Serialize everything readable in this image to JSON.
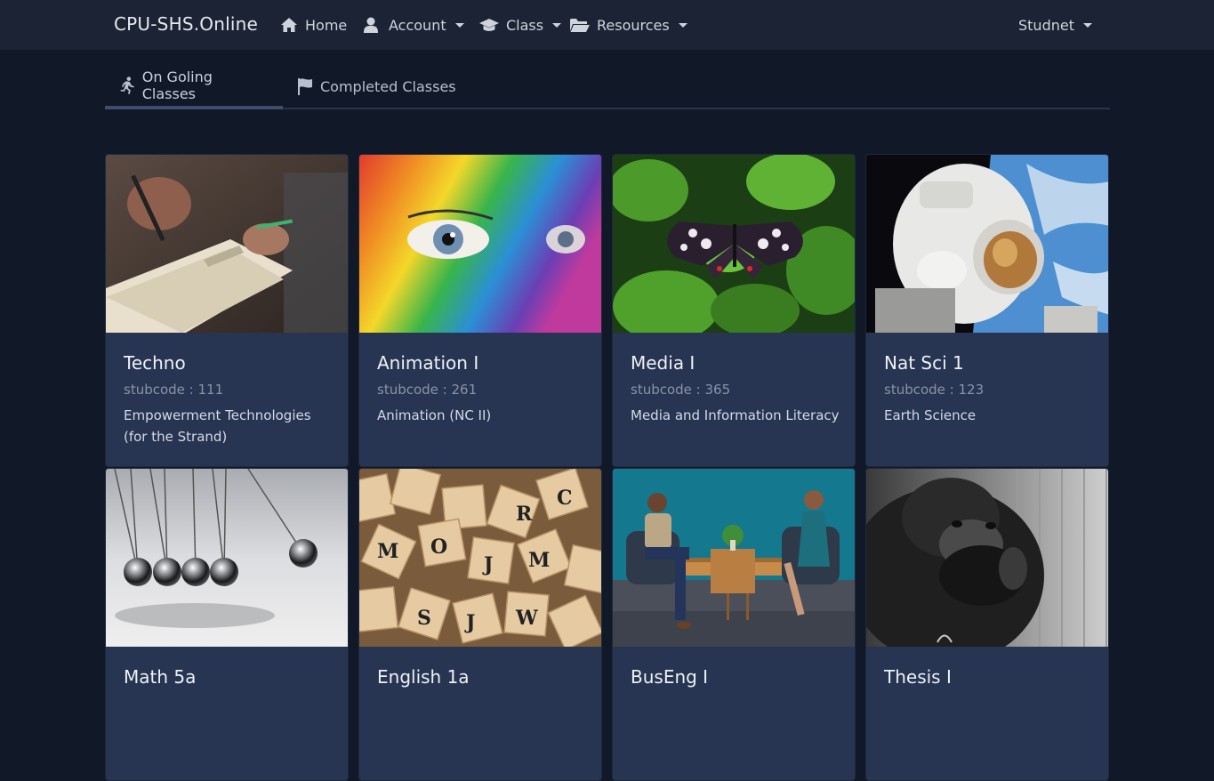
{
  "navbar": {
    "brand": "CPU-SHS.Online",
    "items": [
      {
        "label": "Home",
        "icon": "home-icon"
      },
      {
        "label": "Account",
        "icon": "user-icon"
      },
      {
        "label": "Class",
        "icon": "graduation-cap-icon"
      },
      {
        "label": "Resources",
        "icon": "folder-open-icon"
      }
    ],
    "user_menu": "Studnet"
  },
  "tabs": [
    {
      "label": "On Goling Classes",
      "icon": "running-icon",
      "active": true
    },
    {
      "label": "Completed Classes",
      "icon": "flag-icon",
      "active": false
    }
  ],
  "classes": [
    {
      "title": "Techno",
      "code": "stubcode : 111",
      "description": "Empowerment Technologies (for the Strand)",
      "image": "writing-in-notebook"
    },
    {
      "title": "Animation I",
      "code": "stubcode : 261",
      "description": "Animation (NC II)",
      "image": "rainbow-painted-face"
    },
    {
      "title": "Media I",
      "code": "stubcode : 365",
      "description": "Media and Information Literacy",
      "image": "butterfly-on-leaves"
    },
    {
      "title": "Nat Sci 1",
      "code": "stubcode : 123",
      "description": "Earth Science",
      "image": "astronaut-in-space"
    },
    {
      "title": "Math 5a",
      "code": "",
      "description": "",
      "image": "newtons-cradle"
    },
    {
      "title": "English 1a",
      "code": "",
      "description": "",
      "image": "scrabble-tiles"
    },
    {
      "title": "BusEng I",
      "code": "",
      "description": "",
      "image": "two-people-talking"
    },
    {
      "title": "Thesis I",
      "code": "",
      "description": "",
      "image": "thinking-gorilla"
    }
  ],
  "colors": {
    "background": "#111827",
    "navbar": "#1b2335",
    "card": "#273452",
    "active_tab_underline": "#3e4e6f"
  }
}
